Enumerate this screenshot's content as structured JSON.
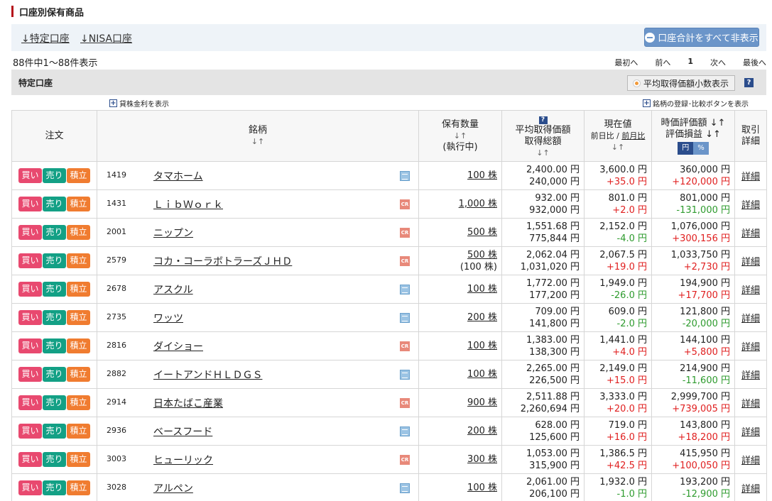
{
  "page": {
    "title": "口座別保有商品",
    "account_links": [
      "↓特定口座",
      "↓NISA口座"
    ],
    "hide_button": "口座合計をすべて非表示",
    "count_text": "88件中1〜88件表示",
    "pager": {
      "first": "最初へ",
      "prev": "前へ",
      "current": "1",
      "next": "次へ",
      "last": "最後へ"
    },
    "section_title": "特定口座",
    "decimal_button": "平均取得価額小数表示",
    "help_glyph": "?",
    "lending_link": "貸株金利を表示",
    "register_link": "銘柄の登録･比較ボタンを表示"
  },
  "headers": {
    "order": "注文",
    "name": "銘柄",
    "name_sort": "↓↑",
    "qty": "保有数量",
    "qty_sort": "↓↑",
    "qty_sub": "(執行中)",
    "avg_line1": "平均取得価額",
    "avg_line2": "取得総額",
    "avg_sort": "↓↑",
    "price": "現在値",
    "price_sub_a": "前日比",
    "price_sep": " / ",
    "price_sub_b": "前月比",
    "price_sort": "↓↑",
    "value": "時価評価額 ↓↑",
    "pl": "評価損益 ↓↑",
    "toggle_yen": "円",
    "toggle_pct": "%",
    "detail_1": "取引",
    "detail_2": "詳細"
  },
  "buttons": {
    "buy": "買い",
    "sell": "売り",
    "accumulate": "積立"
  },
  "detail_label": "詳細",
  "rows": [
    {
      "code": "1419",
      "name": "タマホーム",
      "icon": "chart",
      "qty": "100 株",
      "qty_exec": "",
      "avg": "2,400.00 円",
      "total": "240,000 円",
      "price": "3,600.0 円",
      "change": "+35.0 円",
      "change_dir": "pos",
      "value": "360,000 円",
      "pl": "+120,000 円",
      "pl_dir": "pos"
    },
    {
      "code": "1431",
      "name": "ＬｉｂＷｏｒｋ",
      "icon": "cr",
      "qty": "1,000 株",
      "qty_exec": "",
      "avg": "932.00 円",
      "total": "932,000 円",
      "price": "801.0 円",
      "change": "+2.0 円",
      "change_dir": "pos",
      "value": "801,000 円",
      "pl": "-131,000 円",
      "pl_dir": "neg"
    },
    {
      "code": "2001",
      "name": "ニップン",
      "icon": "cr",
      "qty": "500 株",
      "qty_exec": "",
      "avg": "1,551.68 円",
      "total": "775,844 円",
      "price": "2,152.0 円",
      "change": "-4.0 円",
      "change_dir": "neg",
      "value": "1,076,000 円",
      "pl": "+300,156 円",
      "pl_dir": "pos"
    },
    {
      "code": "2579",
      "name": "コカ・コーラボトラーズＪＨＤ",
      "icon": "cr",
      "qty": "500 株",
      "qty_exec": "(100 株)",
      "avg": "2,062.04 円",
      "total": "1,031,020 円",
      "price": "2,067.5 円",
      "change": "+19.0 円",
      "change_dir": "pos",
      "value": "1,033,750 円",
      "pl": "+2,730 円",
      "pl_dir": "pos"
    },
    {
      "code": "2678",
      "name": "アスクル",
      "icon": "chart",
      "qty": "100 株",
      "qty_exec": "",
      "avg": "1,772.00 円",
      "total": "177,200 円",
      "price": "1,949.0 円",
      "change": "-26.0 円",
      "change_dir": "neg",
      "value": "194,900 円",
      "pl": "+17,700 円",
      "pl_dir": "pos"
    },
    {
      "code": "2735",
      "name": "ワッツ",
      "icon": "chart",
      "qty": "200 株",
      "qty_exec": "",
      "avg": "709.00 円",
      "total": "141,800 円",
      "price": "609.0 円",
      "change": "-2.0 円",
      "change_dir": "neg",
      "value": "121,800 円",
      "pl": "-20,000 円",
      "pl_dir": "neg"
    },
    {
      "code": "2816",
      "name": "ダイショー",
      "icon": "cr",
      "qty": "100 株",
      "qty_exec": "",
      "avg": "1,383.00 円",
      "total": "138,300 円",
      "price": "1,441.0 円",
      "change": "+4.0 円",
      "change_dir": "pos",
      "value": "144,100 円",
      "pl": "+5,800 円",
      "pl_dir": "pos"
    },
    {
      "code": "2882",
      "name": "イートアンドＨＬＤＧＳ",
      "icon": "chart",
      "qty": "100 株",
      "qty_exec": "",
      "avg": "2,265.00 円",
      "total": "226,500 円",
      "price": "2,149.0 円",
      "change": "+15.0 円",
      "change_dir": "pos",
      "value": "214,900 円",
      "pl": "-11,600 円",
      "pl_dir": "neg"
    },
    {
      "code": "2914",
      "name": "日本たばこ産業",
      "icon": "cr",
      "qty": "900 株",
      "qty_exec": "",
      "avg": "2,511.88 円",
      "total": "2,260,694 円",
      "price": "3,333.0 円",
      "change": "+20.0 円",
      "change_dir": "pos",
      "value": "2,999,700 円",
      "pl": "+739,005 円",
      "pl_dir": "pos"
    },
    {
      "code": "2936",
      "name": "ベースフード",
      "icon": "chart",
      "qty": "200 株",
      "qty_exec": "",
      "avg": "628.00 円",
      "total": "125,600 円",
      "price": "719.0 円",
      "change": "+16.0 円",
      "change_dir": "pos",
      "value": "143,800 円",
      "pl": "+18,200 円",
      "pl_dir": "pos"
    },
    {
      "code": "3003",
      "name": "ヒューリック",
      "icon": "cr",
      "qty": "300 株",
      "qty_exec": "",
      "avg": "1,053.00 円",
      "total": "315,900 円",
      "price": "1,386.5 円",
      "change": "+42.5 円",
      "change_dir": "pos",
      "value": "415,950 円",
      "pl": "+100,050 円",
      "pl_dir": "pos"
    },
    {
      "code": "3028",
      "name": "アルペン",
      "icon": "chart",
      "qty": "100 株",
      "qty_exec": "",
      "avg": "2,061.00 円",
      "total": "206,100 円",
      "price": "1,932.0 円",
      "change": "-1.0 円",
      "change_dir": "neg",
      "value": "193,200 円",
      "pl": "-12,900 円",
      "pl_dir": "neg"
    }
  ]
}
